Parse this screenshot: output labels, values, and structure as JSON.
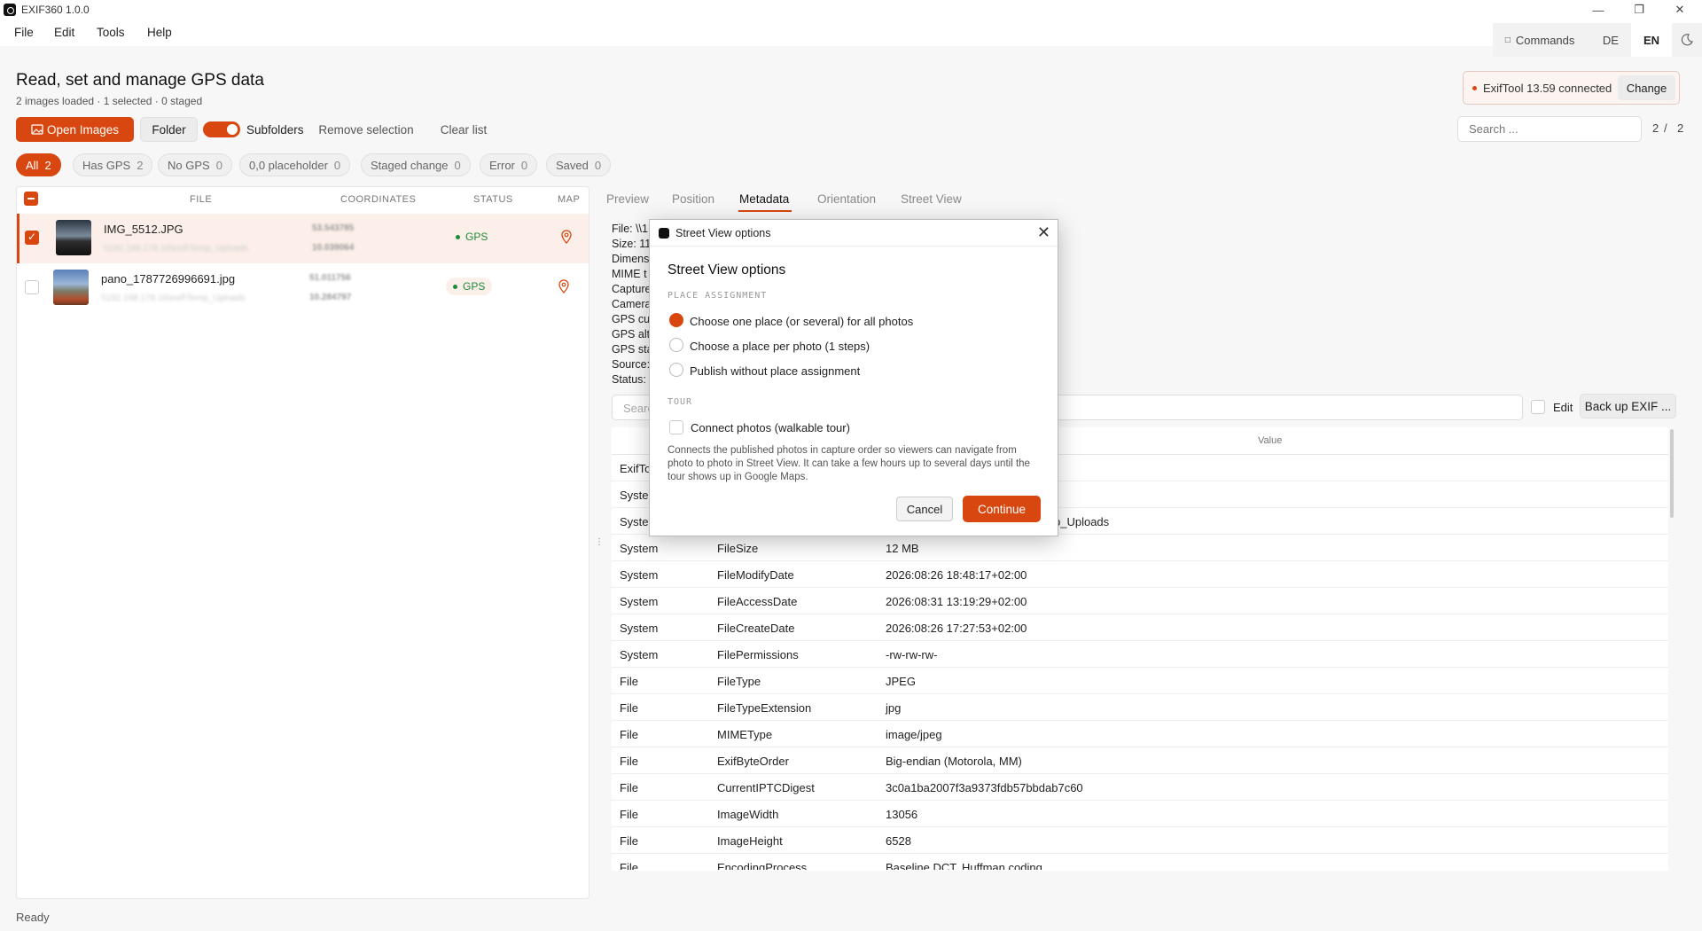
{
  "window": {
    "title": "EXIF360 1.0.0"
  },
  "menu": [
    "File",
    "Edit",
    "Tools",
    "Help"
  ],
  "topright": {
    "commands": "Commands",
    "lang_de": "DE",
    "lang_en": "EN",
    "theme_icon": "moon-icon"
  },
  "header": {
    "title": "Read, set and manage GPS data",
    "subtitle": "2 images loaded · 1 selected · 0 staged"
  },
  "toolbar": {
    "open_images": "Open Images",
    "folder": "Folder",
    "subfolders": "Subfolders",
    "subfolders_on": true,
    "remove_selection": "Remove selection",
    "clear_list": "Clear list"
  },
  "exiftool": {
    "status": "ExifTool 13.59 connected",
    "change": "Change"
  },
  "search": {
    "placeholder": "Search ...",
    "page_current": "2",
    "page_sep": "/",
    "page_total": "2"
  },
  "filters": [
    {
      "label": "All",
      "count": "2",
      "active": true
    },
    {
      "label": "Has GPS",
      "count": "2"
    },
    {
      "label": "No GPS",
      "count": "0"
    },
    {
      "label": "0,0 placeholder",
      "count": "0"
    },
    {
      "label": "Staged change",
      "count": "0"
    },
    {
      "label": "Error",
      "count": "0"
    },
    {
      "label": "Saved",
      "count": "0"
    }
  ],
  "file_table": {
    "headers": [
      "FILE",
      "COORDINATES",
      "STATUS",
      "MAP"
    ],
    "rows": [
      {
        "name": "IMG_5512.JPG",
        "path": "\\\\192.168.178.16\\exif\\Temp_Uploads",
        "lat": "53.543785",
        "lon": "10.039064",
        "status": "GPS",
        "selected": true
      },
      {
        "name": "pano_1787726996691.jpg",
        "path": "\\\\192.168.178.16\\exif\\Temp_Uploads",
        "lat": "51.011756",
        "lon": "10.284797",
        "status": "GPS",
        "selected": false
      }
    ]
  },
  "tabs": [
    "Preview",
    "Position",
    "Metadata",
    "Orientation",
    "Street View"
  ],
  "info_lines": [
    "File: \\\\1",
    "Size: 11",
    "Dimens",
    "MIME t",
    "Capture",
    "Camera",
    "GPS cur",
    "GPS alti",
    "GPS sta",
    "Source:",
    "Status:"
  ],
  "metadata": {
    "search_placeholder": "Searc",
    "edit": "Edit",
    "backup": "Back up EXIF ...",
    "value_header": "Value",
    "rows": [
      {
        "group": "ExifTo",
        "tag": "",
        "value": ""
      },
      {
        "group": "Systen",
        "tag": "",
        "value": ""
      },
      {
        "group": "Systen",
        "tag": "",
        "value": "p_Uploads"
      },
      {
        "group": "System",
        "tag": "FileSize",
        "value": "12 MB"
      },
      {
        "group": "System",
        "tag": "FileModifyDate",
        "value": "2026:08:26 18:48:17+02:00"
      },
      {
        "group": "System",
        "tag": "FileAccessDate",
        "value": "2026:08:31 13:19:29+02:00"
      },
      {
        "group": "System",
        "tag": "FileCreateDate",
        "value": "2026:08:26 17:27:53+02:00"
      },
      {
        "group": "System",
        "tag": "FilePermissions",
        "value": "-rw-rw-rw-"
      },
      {
        "group": "File",
        "tag": "FileType",
        "value": "JPEG"
      },
      {
        "group": "File",
        "tag": "FileTypeExtension",
        "value": "jpg"
      },
      {
        "group": "File",
        "tag": "MIMEType",
        "value": "image/jpeg"
      },
      {
        "group": "File",
        "tag": "ExifByteOrder",
        "value": "Big-endian (Motorola, MM)"
      },
      {
        "group": "File",
        "tag": "CurrentIPTCDigest",
        "value": "3c0a1ba2007f3a9373fdb57bbdab7c60"
      },
      {
        "group": "File",
        "tag": "ImageWidth",
        "value": "13056"
      },
      {
        "group": "File",
        "tag": "ImageHeight",
        "value": "6528"
      },
      {
        "group": "File",
        "tag": "EncodingProcess",
        "value": "Baseline DCT, Huffman coding"
      }
    ]
  },
  "statusbar": "Ready",
  "dialog": {
    "window_title": "Street View options",
    "heading": "Street View options",
    "section_place": "PLACE ASSIGNMENT",
    "options": [
      {
        "label": "Choose one place (or several) for all photos",
        "selected": true
      },
      {
        "label": "Choose a place per photo (1 steps)",
        "selected": false
      },
      {
        "label": "Publish without place assignment",
        "selected": false
      }
    ],
    "section_tour": "TOUR",
    "tour_label": "Connect photos (walkable tour)",
    "tour_checked": false,
    "description": "Connects the published photos in capture order so viewers can navigate from photo to photo in Street View. It can take a few hours up to several days until the tour shows up in Google Maps.",
    "cancel": "Cancel",
    "continue": "Continue"
  },
  "colors": {
    "accent": "#d8470f",
    "gps_green": "#1f8a3a"
  }
}
